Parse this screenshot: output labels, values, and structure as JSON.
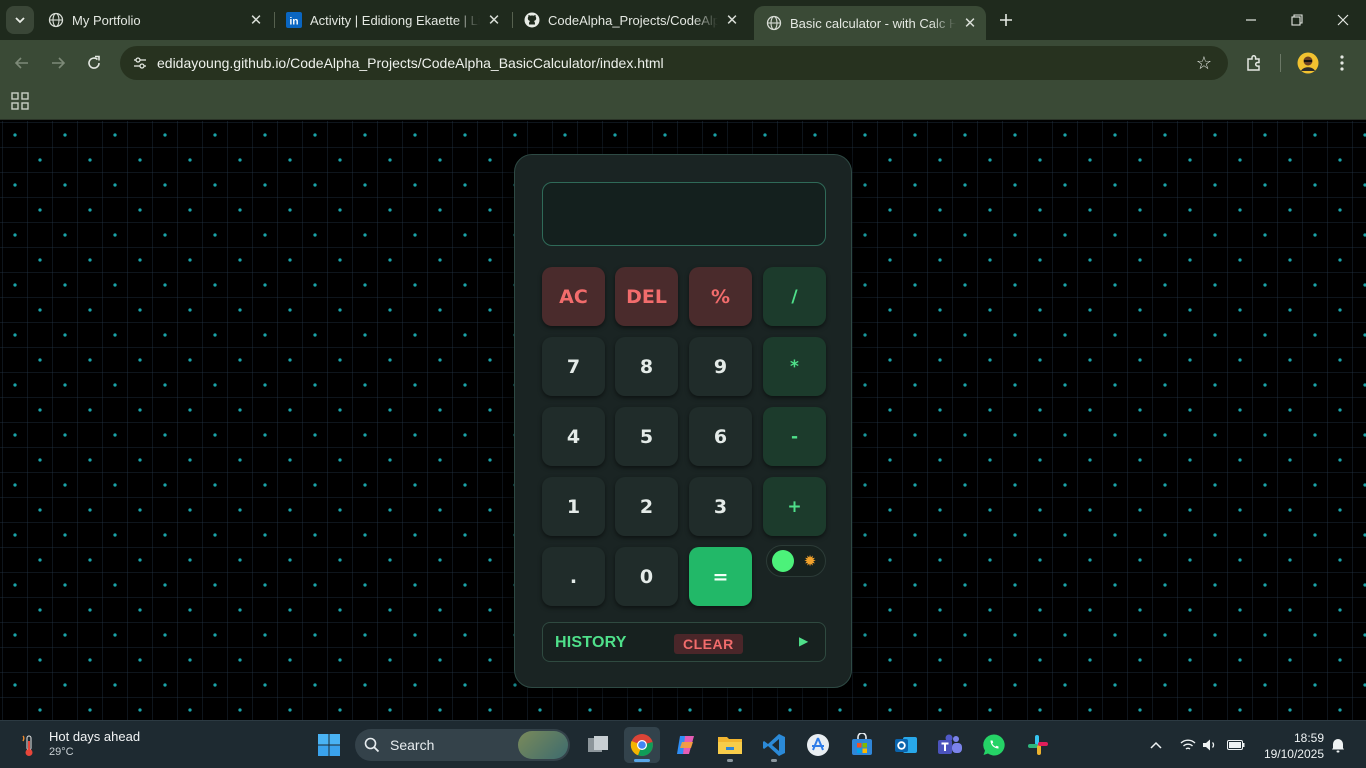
{
  "browser": {
    "tabs": [
      {
        "title": "My Portfolio",
        "favicon": "globe-icon",
        "active": false
      },
      {
        "title": "Activity | Edidiong Ekaette | LinkedIn",
        "favicon": "linkedin-icon",
        "active": false
      },
      {
        "title": "CodeAlpha_Projects/CodeAlpha_BasicCalculator",
        "favicon": "github-icon",
        "active": false
      },
      {
        "title": "Basic calculator - with Calc History",
        "favicon": "globe-icon",
        "active": true
      }
    ],
    "url": "edidayoung.github.io/CodeAlpha_Projects/CodeAlpha_BasicCalculator/index.html",
    "theme_color": "#3a4a36"
  },
  "calculator": {
    "display_value": "",
    "keys": {
      "ac": "AC",
      "del": "DEL",
      "percent": "%",
      "divide": "/",
      "seven": "7",
      "eight": "8",
      "nine": "9",
      "multiply": "*",
      "four": "4",
      "five": "5",
      "six": "6",
      "minus": "-",
      "one": "1",
      "two": "2",
      "three": "3",
      "plus": "+",
      "dot": ".",
      "zero": "0",
      "equals": "="
    },
    "theme_toggle": {
      "state": "dark",
      "icon": "sun-icon"
    },
    "history": {
      "label": "HISTORY",
      "clear_label": "CLEAR",
      "expand_icon": "play-arrow-icon"
    },
    "colors": {
      "accent_green": "#4fe08a",
      "accent_red": "#f26c6c",
      "equals": "#22b868"
    }
  },
  "taskbar": {
    "weather": {
      "headline": "Hot days ahead",
      "temperature": "29°C"
    },
    "search_label": "Search",
    "apps": [
      "start-icon",
      "search",
      "task-view-icon",
      "chrome-icon",
      "copilot-icon",
      "file-explorer-icon",
      "vscode-icon",
      "app-store-icon",
      "microsoft-store-icon",
      "outlook-icon",
      "teams-icon",
      "whatsapp-icon",
      "slack-icon"
    ],
    "clock": {
      "time": "18:59",
      "date": "19/10/2025"
    }
  }
}
